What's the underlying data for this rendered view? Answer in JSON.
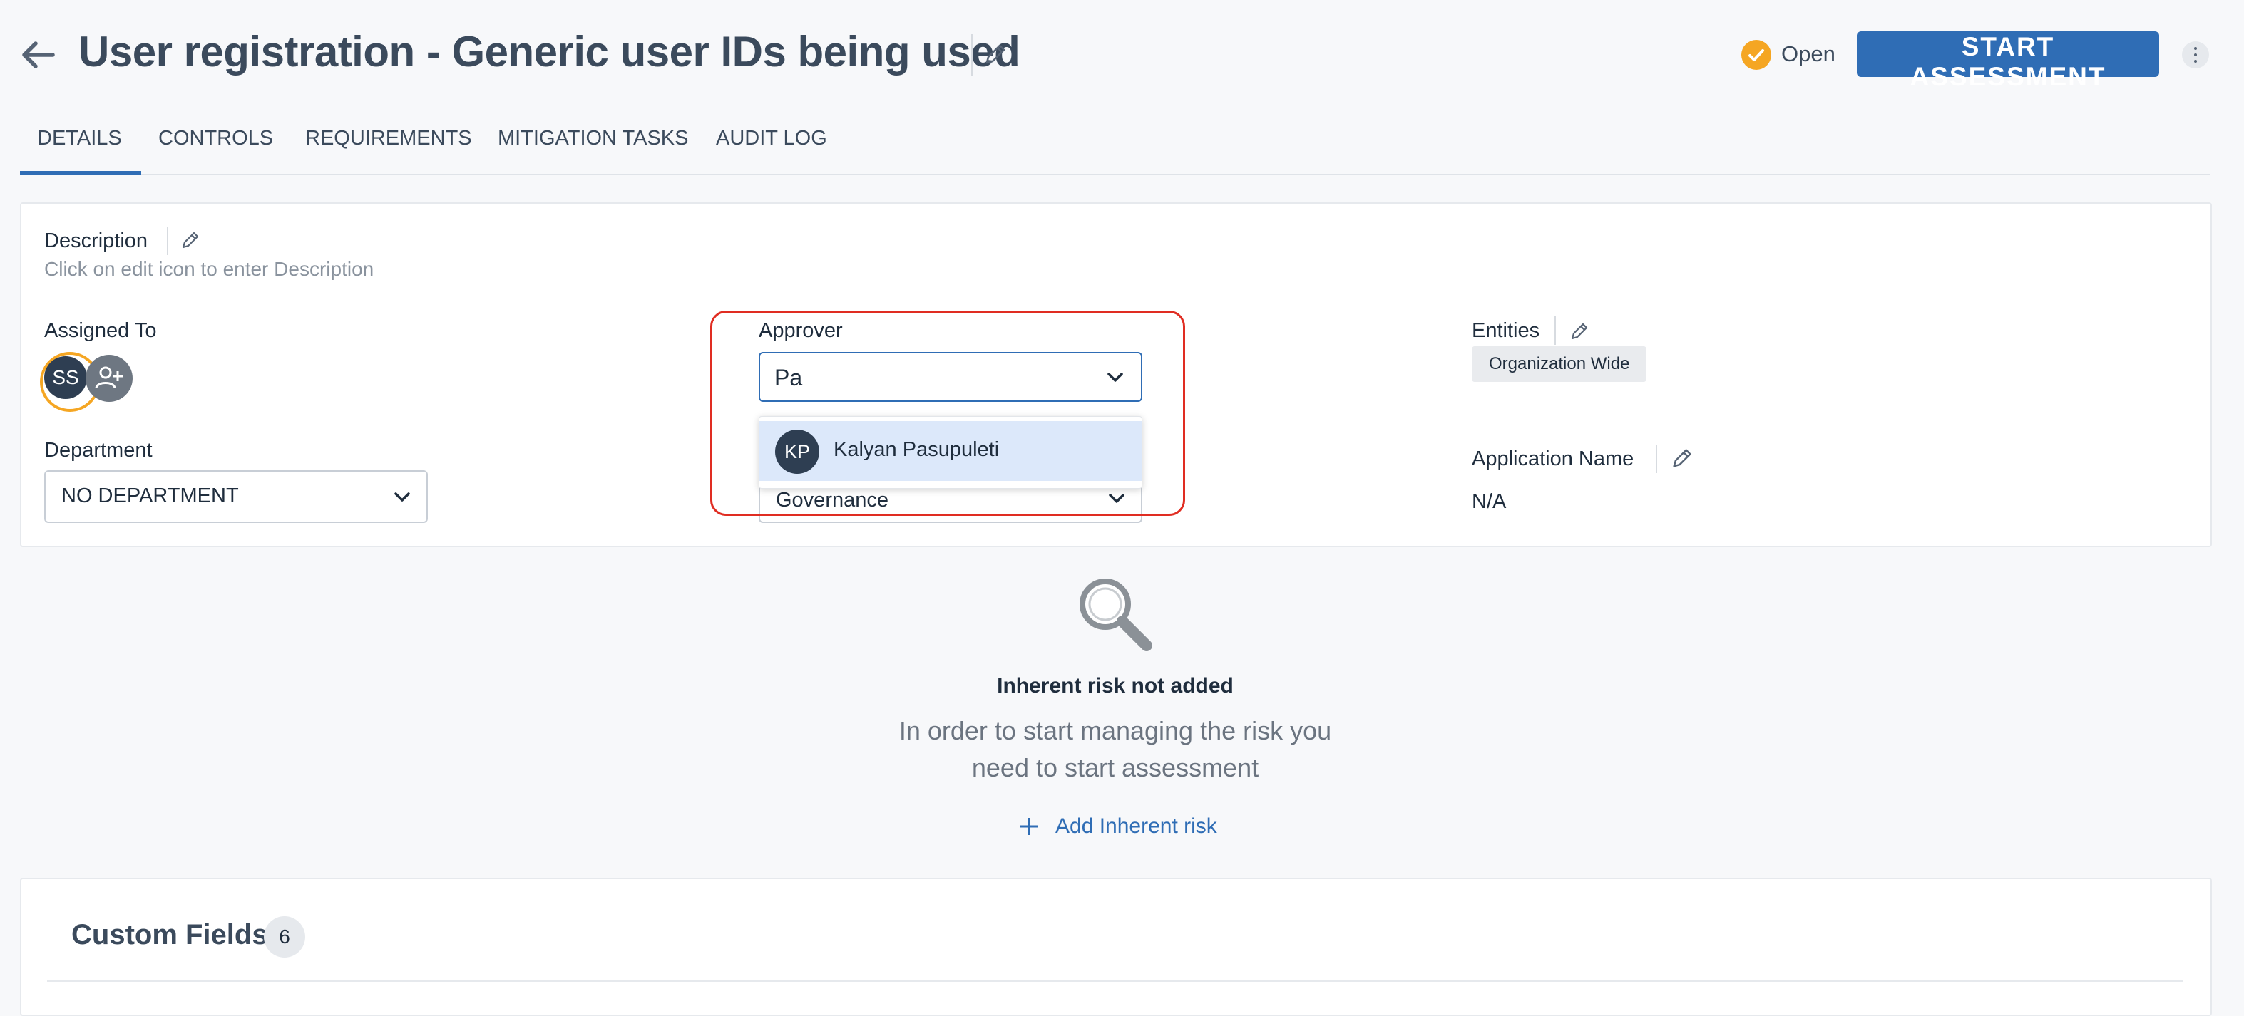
{
  "header": {
    "title": "User registration - Generic user IDs being used",
    "status": "Open",
    "start_button": "START ASSESSMENT"
  },
  "tabs": [
    {
      "label": "DETAILS",
      "active": true
    },
    {
      "label": "CONTROLS",
      "active": false
    },
    {
      "label": "REQUIREMENTS",
      "active": false
    },
    {
      "label": "MITIGATION TASKS",
      "active": false
    },
    {
      "label": "AUDIT LOG",
      "active": false
    }
  ],
  "details": {
    "description_label": "Description",
    "description_placeholder": "Click on edit icon to enter Description",
    "assigned_to_label": "Assigned To",
    "assignee_initials": "SS",
    "department_label": "Department",
    "department_value": "NO DEPARTMENT",
    "approver_label": "Approver",
    "approver_input_value": "Pa",
    "approver_options": [
      {
        "initials": "KP",
        "name": "Kalyan Pasupuleti"
      }
    ],
    "category_value": "Governance",
    "entities_label": "Entities",
    "entities_chip": "Organization Wide",
    "application_name_label": "Application Name",
    "application_name_value": "N/A"
  },
  "empty_state": {
    "title": "Inherent risk not added",
    "message_line1": "In order to start managing the risk you",
    "message_line2": "need to start assessment",
    "action": "Add Inherent risk"
  },
  "custom_fields": {
    "title": "Custom Fields",
    "count": "6"
  },
  "colors": {
    "primary": "#2f6db5",
    "status_open": "#f5a623",
    "highlight_border": "#e02d22",
    "selected_option_bg": "#dce8fa"
  },
  "icons": [
    "back-arrow-icon",
    "pencil-icon",
    "check-circle-icon",
    "kebab-icon",
    "add-user-icon",
    "chevron-down-icon",
    "magnifier-icon",
    "plus-icon"
  ]
}
